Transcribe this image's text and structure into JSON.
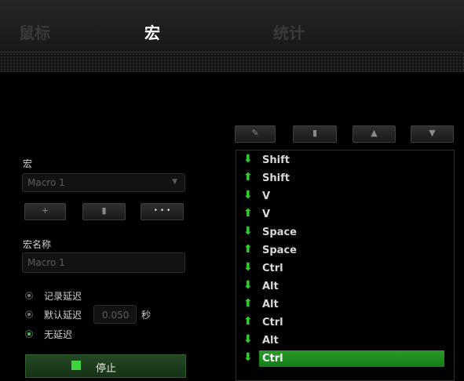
{
  "tabs": [
    {
      "label": "鼠标"
    },
    {
      "label": "宏"
    },
    {
      "label": "统计"
    }
  ],
  "active_tab": "宏",
  "toolbar": [
    {
      "icon": "pencil-icon",
      "glyph": "✎"
    },
    {
      "icon": "trash-icon",
      "glyph": "▮"
    },
    {
      "icon": "move-up-icon",
      "glyph": "▲"
    },
    {
      "icon": "move-down-icon",
      "glyph": "▼"
    }
  ],
  "macro": {
    "label": "宏",
    "selected": "Macro 1",
    "caret": "▼",
    "buttons": [
      {
        "icon": "add-icon",
        "glyph": "+"
      },
      {
        "icon": "trash-icon",
        "glyph": "▮"
      },
      {
        "icon": "more-icon",
        "glyph": "• • •"
      }
    ]
  },
  "macro_name": {
    "label": "宏名称",
    "value": "Macro 1"
  },
  "delay_options": {
    "record": "记录延迟",
    "default": "默认延迟",
    "default_value": "0.050",
    "unit": "秒",
    "none": "无延迟",
    "selected": "none"
  },
  "stop_button": {
    "label": "停止"
  },
  "events": [
    {
      "dir": "down",
      "key": "Shift"
    },
    {
      "dir": "up",
      "key": "Shift"
    },
    {
      "dir": "down",
      "key": "V"
    },
    {
      "dir": "up",
      "key": "V"
    },
    {
      "dir": "down",
      "key": "Space"
    },
    {
      "dir": "up",
      "key": "Space"
    },
    {
      "dir": "down",
      "key": "Ctrl"
    },
    {
      "dir": "down",
      "key": "Alt"
    },
    {
      "dir": "up",
      "key": "Alt"
    },
    {
      "dir": "up",
      "key": "Ctrl"
    },
    {
      "dir": "down",
      "key": "Alt"
    },
    {
      "dir": "down",
      "key": "Ctrl",
      "selected": true
    }
  ],
  "colors": {
    "accent": "#3cd23c",
    "selected_row": "#1f8c1f",
    "background": "#000000"
  }
}
